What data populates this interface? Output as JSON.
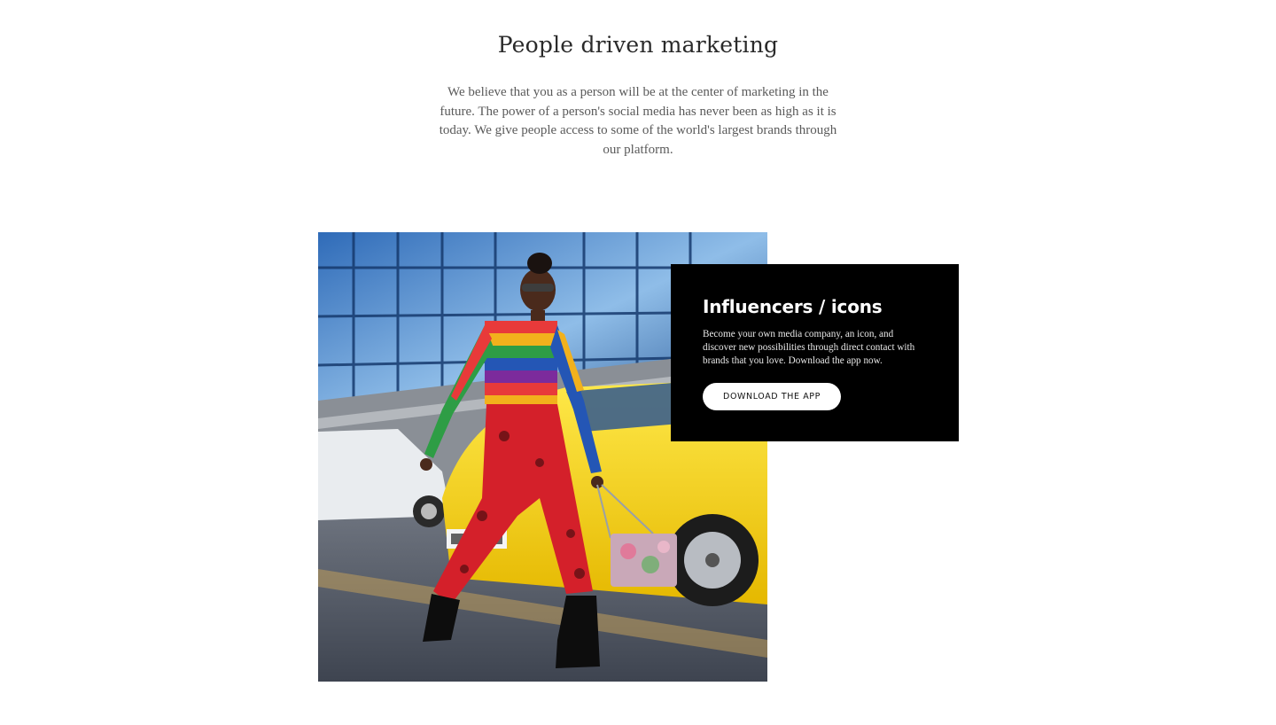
{
  "intro": {
    "title": "People driven marketing",
    "text": "We believe that you as a person will be at the center of marketing in the future. The power of a person's social media has never been as high as it is today. We give people access to some of the world's largest brands through our platform."
  },
  "feature": {
    "image_subject": "influencer-photo",
    "card": {
      "title": "Influencers / icons",
      "text": "Become your own media company, an icon, and discover new possibilities through direct contact with brands that you love. Download the app now.",
      "button_label": "DOWNLOAD THE APP"
    }
  },
  "colors": {
    "background": "#ffffff",
    "card_background": "#000000",
    "button_background": "#ffffff",
    "heading_text": "#2a2a2a",
    "body_text": "#5a5a5a"
  }
}
